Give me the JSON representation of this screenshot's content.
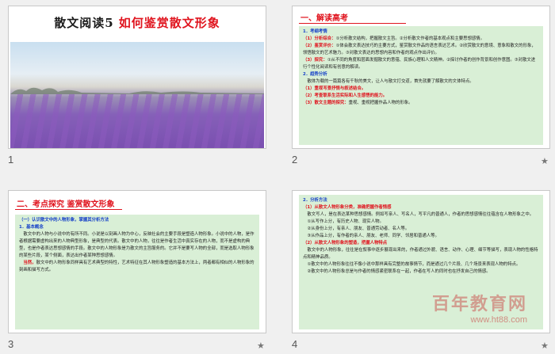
{
  "slides": [
    {
      "number": "1",
      "title_black": "散文阅读5",
      "title_red": "如何鉴赏散文形象"
    },
    {
      "number": "2",
      "heading": "一、解读高考",
      "lines": [
        {
          "style": "blue",
          "text": "1．考纲考情"
        },
        {
          "style": "mixed",
          "red": "（1）分析综合：",
          "text": "①分析散文结构，把握散文主旨。②分析散文作者的基本观点和主要思想感情。"
        },
        {
          "style": "mixed",
          "red": "（2）鉴赏评价：",
          "text": "①体会散文表达技巧的主要方式，鉴赏散文作品的语言表达艺术。②欣赏散文的意境、意象和散文的形象，领悟散文的艺术魅力。③对散文表达的思想内容和作者的观点作出评价。"
        },
        {
          "style": "mixed",
          "red": "（3）探究：",
          "text": "①从不同的角度和层面发掘散文的意蕴、民族心理和人文精神。②探讨作者的创作背景和创作意图。③对散文进行个性化阅读和有创意的解读。"
        },
        {
          "style": "blue",
          "text": "2．趋势分析"
        },
        {
          "style": "plain",
          "text": "　散体为载的一篇篇各有千秋的美文，让人与散文打交道，首先就要了解散文的文体特点。"
        },
        {
          "style": "red",
          "text": "（1）重视写景抒情与叙述结合。"
        },
        {
          "style": "red",
          "text": "（2）考查联系生活实际和人生感悟的能力。"
        },
        {
          "style": "mixed",
          "red": "（3）散文主题的探究：",
          "text": "重视、重视把握作品人物的形象。"
        }
      ]
    },
    {
      "number": "3",
      "heading": "二、考点探究 鉴赏散文形象",
      "lines": [
        {
          "style": "blue",
          "text": "（一）认识散文中的人物形象，掌握其分析方法"
        },
        {
          "style": "blue",
          "text": "1．基本概念"
        },
        {
          "style": "plain",
          "text": "　散文中的人物与小说中的有所不同。小说是以刻画人物为中心，反映社会的主要手段是塑造人物形象。小说中的人物，是作者根据需要虚构出来的人物典型形象，是典型的代表。散文中的人物，往往是作者生活中真实存在的人物，而不是虚构的典型，也是作者表达思想感情的手段。散文中的人物形象是为散文的主旨服务的。它并不是要写人物的全部，而是选取人物形象的某些片段，某个侧面，表达出作者某种思想感情。"
        },
        {
          "style": "mixed",
          "red": "　当然，",
          "text": "散文中的人物形象同样具有艺术典型的特性，艺术特征在其人物形象塑造的基本方法上，两者都有相似的人物形象的刻画和描写方式。"
        }
      ]
    },
    {
      "number": "4",
      "lines": [
        {
          "style": "blue",
          "text": "2．分析方法"
        },
        {
          "style": "red",
          "text": "（1）从散文人物形象分类，准确把握作者情感"
        },
        {
          "style": "plain",
          "text": "　散文写人，是在表达某种思想感情。例如写亲人、写名人，写平凡的普通人，作者的思想感情往往蕴含在人物形象之中。"
        },
        {
          "style": "plain",
          "text": "　①从写作上分，有历史人物、现实人物。"
        },
        {
          "style": "plain",
          "text": "　②从身份上分，有亲人、朋友、普通劳动者、名人等。"
        },
        {
          "style": "plain",
          "text": "　③从作品上分，有作者的亲人、朋友、老师、同学、邻居和普通人等。"
        },
        {
          "style": "red",
          "text": "（2）从散文人物形象的塑造，把握人物特点"
        },
        {
          "style": "plain",
          "text": "　散文中的人物形象，往往是在叙事中逐步展现出来的，作者通过外貌、语言、动作、心理、细节等描写，表现人物的性格特点和精神品质。"
        },
        {
          "style": "plain",
          "text": "　①散文中的人物形象往往不像小说中那样具有完整的故事情节，而是通过几个片段、几个场景来表现人物的特点。"
        },
        {
          "style": "plain",
          "text": "　②散文中的人物形象总是与作者的情感紧密联系在一起，作者在写人的同时也在抒发自己的情感。"
        }
      ]
    }
  ],
  "watermark": {
    "text": "百年教育网",
    "url": "www.ht88.com"
  }
}
